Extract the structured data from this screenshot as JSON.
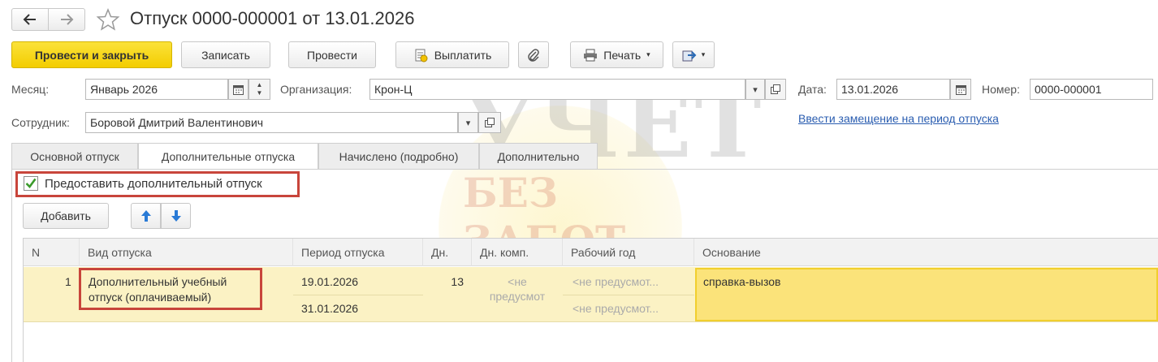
{
  "window": {
    "title": "Отпуск 0000-000001 от 13.01.2026",
    "back_icon": "arrow-left-icon",
    "forward_icon": "arrow-right-icon",
    "favorite_icon": "star-icon"
  },
  "toolbar": {
    "post_close_label": "Провести и закрыть",
    "save_label": "Записать",
    "post_label": "Провести",
    "pay_label": "Выплатить",
    "print_label": "Печать",
    "attach_icon": "paperclip-icon",
    "print_icon": "printer-icon",
    "export_icon": "export-icon"
  },
  "form": {
    "month_label": "Месяц:",
    "month_value": "Январь 2026",
    "org_label": "Организация:",
    "org_value": "Крон-Ц",
    "date_label": "Дата:",
    "date_value": "13.01.2026",
    "number_label": "Номер:",
    "number_value": "0000-000001",
    "employee_label": "Сотрудник:",
    "employee_value": "Боровой Дмитрий Валентинович",
    "replacement_link": "Ввести замещение на период отпуска"
  },
  "tabs": [
    {
      "label": "Основной отпуск"
    },
    {
      "label": "Дополнительные отпуска"
    },
    {
      "label": "Начислено (подробно)"
    },
    {
      "label": "Дополнительно"
    }
  ],
  "active_tab": "Дополнительные отпуска",
  "additional": {
    "checkbox_label": "Предоставить дополнительный отпуск",
    "checkbox_checked": true,
    "add_label": "Добавить",
    "up_icon": "arrow-up-icon",
    "down_icon": "arrow-down-icon"
  },
  "table": {
    "columns": [
      "N",
      "Вид отпуска",
      "Период отпуска",
      "Дн.",
      "Дн. комп.",
      "Рабочий год",
      "Основание"
    ],
    "rows": [
      {
        "n": "1",
        "kind_line1": "Дополнительный учебный",
        "kind_line2": "отпуск (оплачиваемый)",
        "period_from": "19.01.2026",
        "period_to": "31.01.2026",
        "days": "13",
        "comp_line1": "<не",
        "comp_line2": "предусмот",
        "work_year_from": "<не предусмот...",
        "work_year_to": "<не предусмот...",
        "basis": "справка-вызов"
      }
    ]
  },
  "watermark": {
    "line1": "УЧЕТ",
    "line2": "БЕЗ ЗАБОТ"
  },
  "colors": {
    "accent_yellow": "#f5d20a",
    "selected_row": "#fbf2c4",
    "highlight_box": "#c8453b",
    "link": "#2a5db0",
    "check_green": "#3a9a2a"
  }
}
